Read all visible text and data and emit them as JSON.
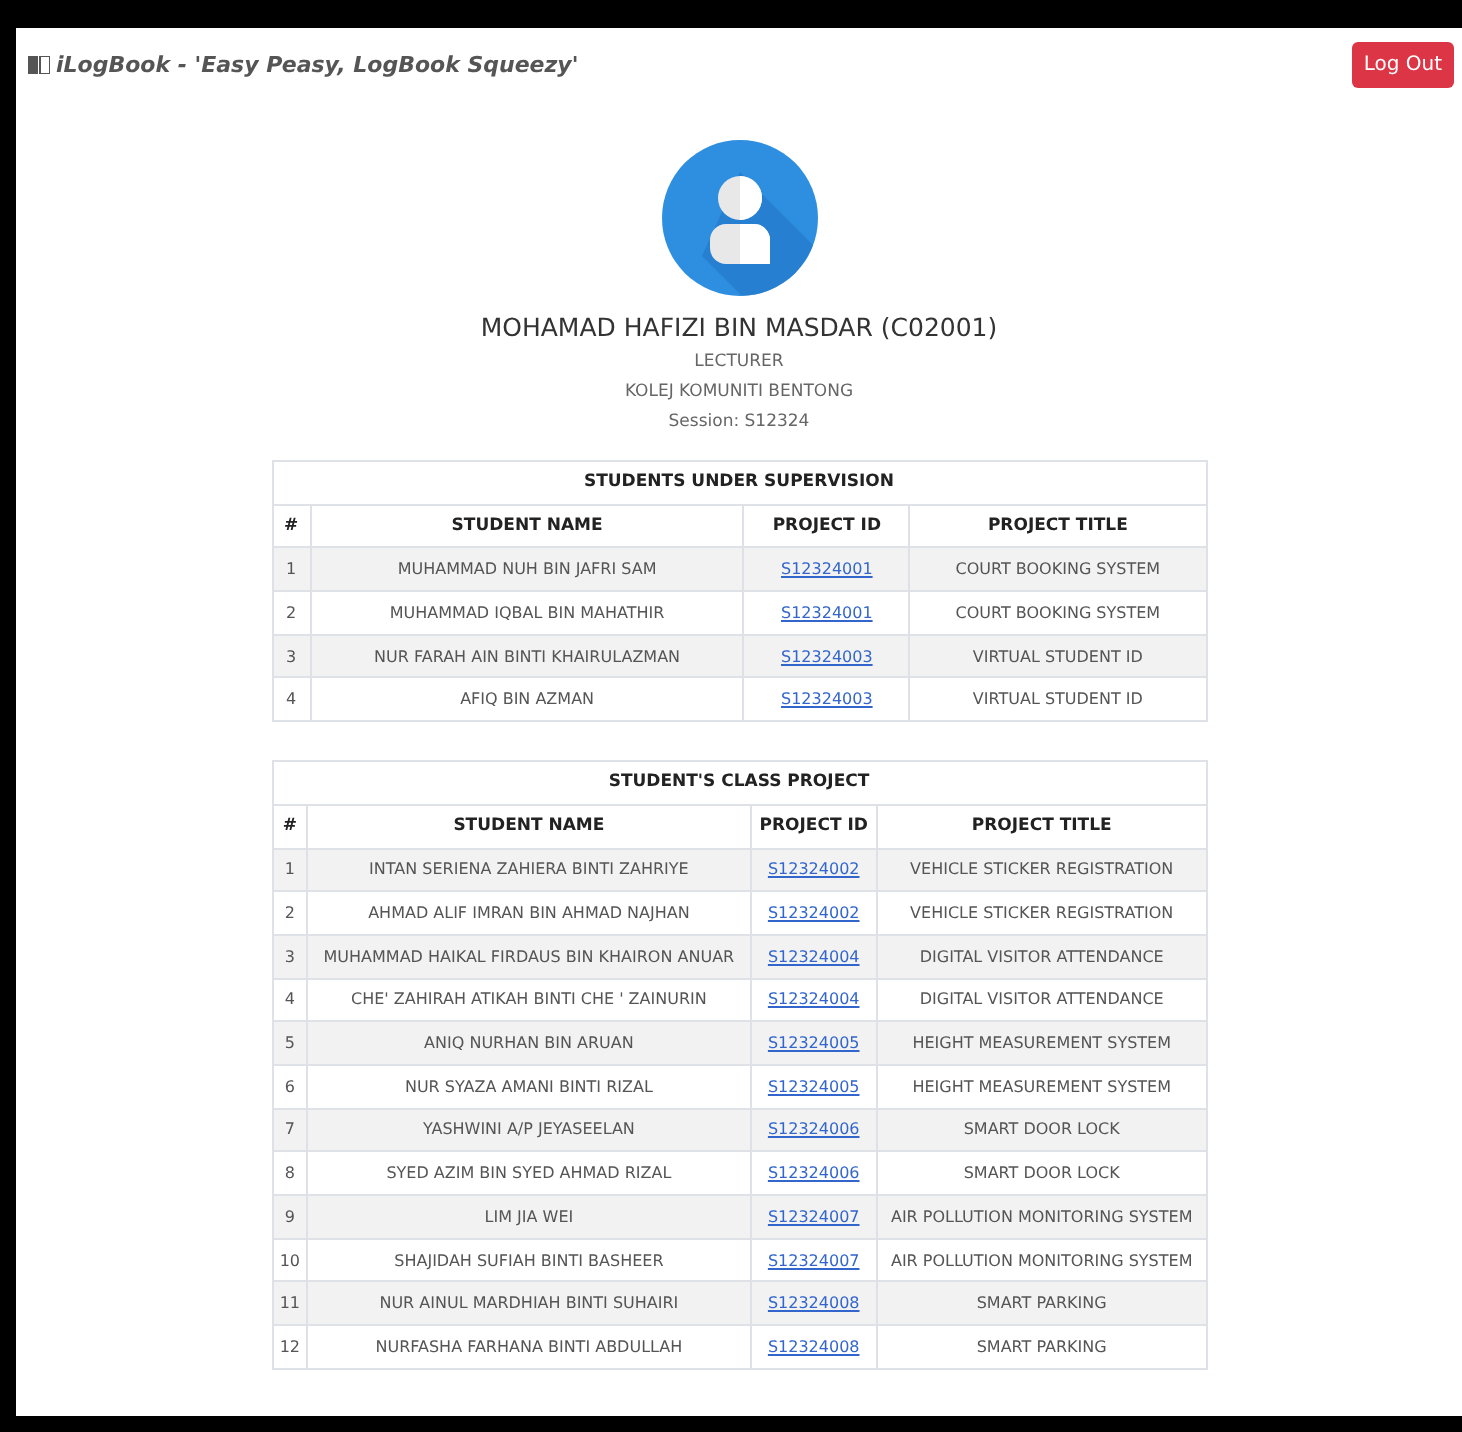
{
  "navbar": {
    "brand": "iLogBook - 'Easy Peasy, LogBook Squeezy'",
    "logout_button": "Log Out"
  },
  "profile": {
    "name": "MOHAMAD HAFIZI BIN MASDAR (C02001)",
    "role": "LECTURER",
    "institution": "KOLEJ KOMUNITI BENTONG",
    "session": "Session: S12324"
  },
  "tables": [
    {
      "title": "STUDENTS UNDER SUPERVISION",
      "columns": [
        "#",
        "STUDENT NAME",
        "PROJECT ID",
        "PROJECT TITLE"
      ],
      "rows": [
        [
          "1",
          "MUHAMMAD NUH BIN JAFRI SAM",
          "S12324001",
          "COURT BOOKING SYSTEM"
        ],
        [
          "2",
          "MUHAMMAD IQBAL BIN MAHATHIR",
          "S12324001",
          "COURT BOOKING SYSTEM"
        ],
        [
          "3",
          "NUR FARAH AIN BINTI KHAIRULAZMAN",
          "S12324003",
          "VIRTUAL STUDENT ID"
        ],
        [
          "4",
          "AFIQ BIN AZMAN",
          "S12324003",
          "VIRTUAL STUDENT ID"
        ]
      ]
    },
    {
      "title": "STUDENT'S CLASS PROJECT",
      "columns": [
        "#",
        "STUDENT NAME",
        "PROJECT ID",
        "PROJECT TITLE"
      ],
      "rows": [
        [
          "1",
          "INTAN SERIENA ZAHIERA BINTI ZAHRIYE",
          "S12324002",
          "VEHICLE STICKER REGISTRATION"
        ],
        [
          "2",
          "AHMAD ALIF IMRAN BIN AHMAD NAJHAN",
          "S12324002",
          "VEHICLE STICKER REGISTRATION"
        ],
        [
          "3",
          "MUHAMMAD HAIKAL FIRDAUS BIN KHAIRON ANUAR",
          "S12324004",
          "DIGITAL VISITOR ATTENDANCE"
        ],
        [
          "4",
          "CHE' ZAHIRAH ATIKAH BINTI CHE ' ZAINURIN",
          "S12324004",
          "DIGITAL VISITOR ATTENDANCE"
        ],
        [
          "5",
          "ANIQ NURHAN BIN ARUAN",
          "S12324005",
          "HEIGHT MEASUREMENT SYSTEM"
        ],
        [
          "6",
          "NUR SYAZA AMANI BINTI RIZAL",
          "S12324005",
          "HEIGHT MEASUREMENT SYSTEM"
        ],
        [
          "7",
          "YASHWINI A/P JEYASEELAN",
          "S12324006",
          "SMART DOOR LOCK"
        ],
        [
          "8",
          "SYED AZIM BIN SYED AHMAD RIZAL",
          "S12324006",
          "SMART DOOR LOCK"
        ],
        [
          "9",
          "LIM JIA WEI",
          "S12324007",
          "AIR POLLUTION MONITORING SYSTEM"
        ],
        [
          "10",
          "SHAJIDAH SUFIAH BINTI BASHEER",
          "S12324007",
          "AIR POLLUTION MONITORING SYSTEM"
        ],
        [
          "11",
          "NUR AINUL MARDHIAH BINTI SUHAIRI",
          "S12324008",
          "SMART PARKING"
        ],
        [
          "12",
          "NURFASHA FARHANA BINTI ABDULLAH",
          "S12324008",
          "SMART PARKING"
        ]
      ]
    }
  ]
}
